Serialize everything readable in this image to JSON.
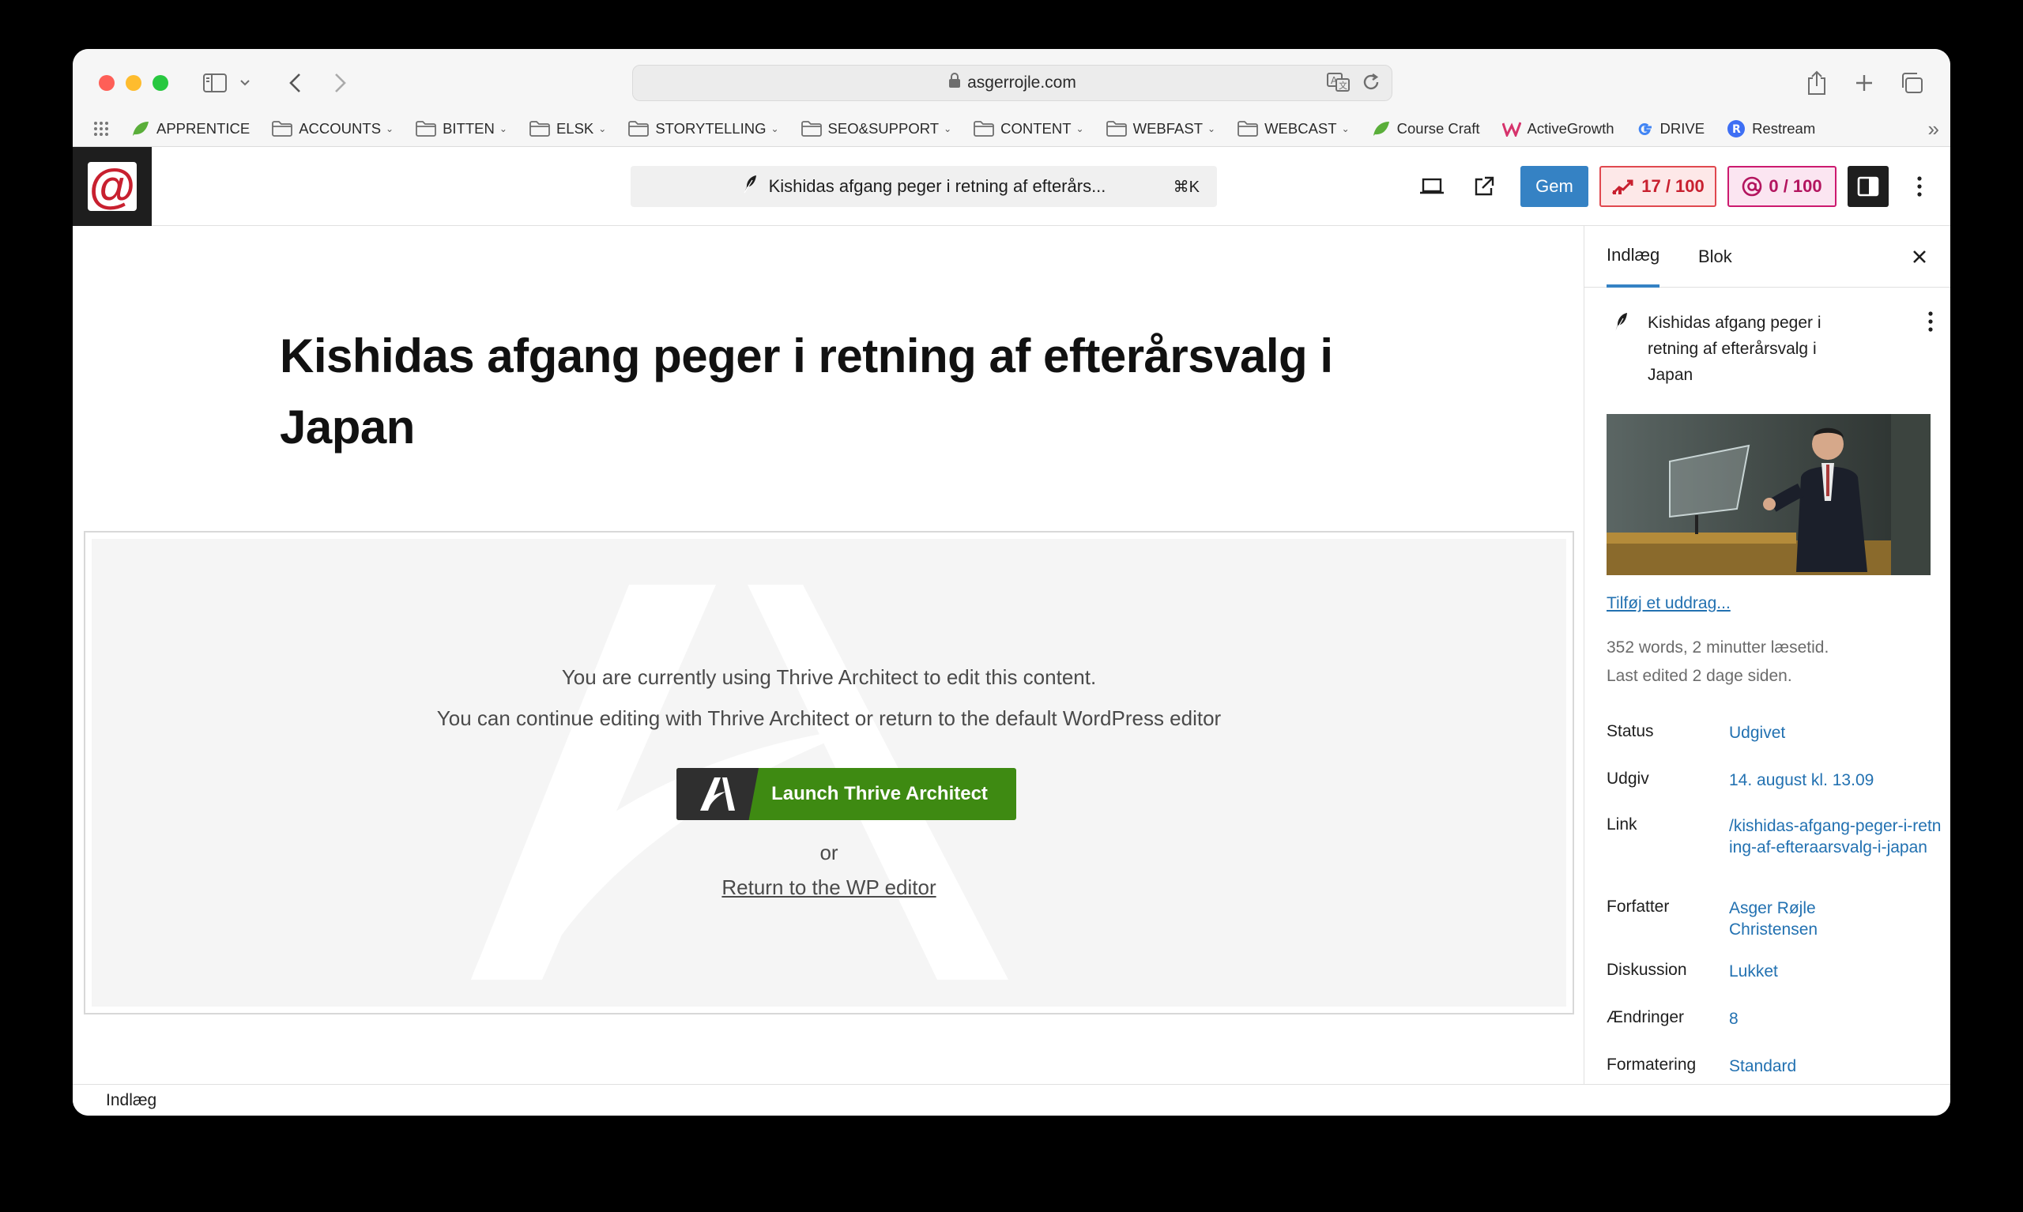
{
  "browser": {
    "url": "asgerrojle.com",
    "bookmarks": [
      {
        "label": "APPRENTICE",
        "icon": "leaf-icon",
        "folder": false
      },
      {
        "label": "ACCOUNTS",
        "icon": "folder-icon",
        "folder": true
      },
      {
        "label": "BITTEN",
        "icon": "folder-icon",
        "folder": true
      },
      {
        "label": "ELSK",
        "icon": "folder-icon",
        "folder": true
      },
      {
        "label": "STORYTELLING",
        "icon": "folder-icon",
        "folder": true
      },
      {
        "label": "SEO&SUPPORT",
        "icon": "folder-icon",
        "folder": true
      },
      {
        "label": "CONTENT",
        "icon": "folder-icon",
        "folder": true
      },
      {
        "label": "WEBFAST",
        "icon": "folder-icon",
        "folder": true
      },
      {
        "label": "WEBCAST",
        "icon": "folder-icon",
        "folder": true
      },
      {
        "label": "Course Craft",
        "icon": "leaf-icon",
        "folder": false
      },
      {
        "label": "ActiveGrowth",
        "icon": "w-logo-icon",
        "folder": false
      },
      {
        "label": "DRIVE",
        "icon": "g-logo-icon",
        "folder": false
      },
      {
        "label": "Restream",
        "icon": "r-logo-icon",
        "folder": false
      }
    ]
  },
  "editor": {
    "document_title": "Kishidas afgang peger i retning af efterårs...",
    "shortcut": "⌘K",
    "save_label": "Gem",
    "seo_score": "17 / 100",
    "readability_score": "0 / 100"
  },
  "post": {
    "title": "Kishidas afgang peger i retning af efterårsvalg i Japan"
  },
  "thrive": {
    "line1": "You are currently using Thrive Architect to edit this content.",
    "line2": "You can continue editing with Thrive Architect or return to the default WordPress editor",
    "launch_label": "Launch Thrive Architect",
    "or": "or",
    "return_label": "Return to the WP editor"
  },
  "sidebar": {
    "tabs": [
      "Indlæg",
      "Blok"
    ],
    "post_title": "Kishidas afgang peger i retning af efterårsvalg i Japan",
    "excerpt_link": "Tilføj et uddrag...",
    "word_count": "352 words, 2 minutter læsetid.",
    "last_edited": "Last edited 2 dage siden.",
    "props": [
      {
        "label": "Status",
        "value": "Udgivet"
      },
      {
        "label": "Udgiv",
        "value": "14. august kl. 13.09"
      },
      {
        "label": "Link",
        "value": "/kishidas-afgang-peger-i-retning-af-efteraarsvalg-i-japan"
      },
      {
        "label": "Forfatter",
        "value": "Asger Røjle Christensen"
      },
      {
        "label": "Diskussion",
        "value": "Lukket"
      },
      {
        "label": "Ændringer",
        "value": "8"
      },
      {
        "label": "Formatering",
        "value": "Standard"
      }
    ]
  },
  "footer": {
    "breadcrumb": "Indlæg"
  }
}
